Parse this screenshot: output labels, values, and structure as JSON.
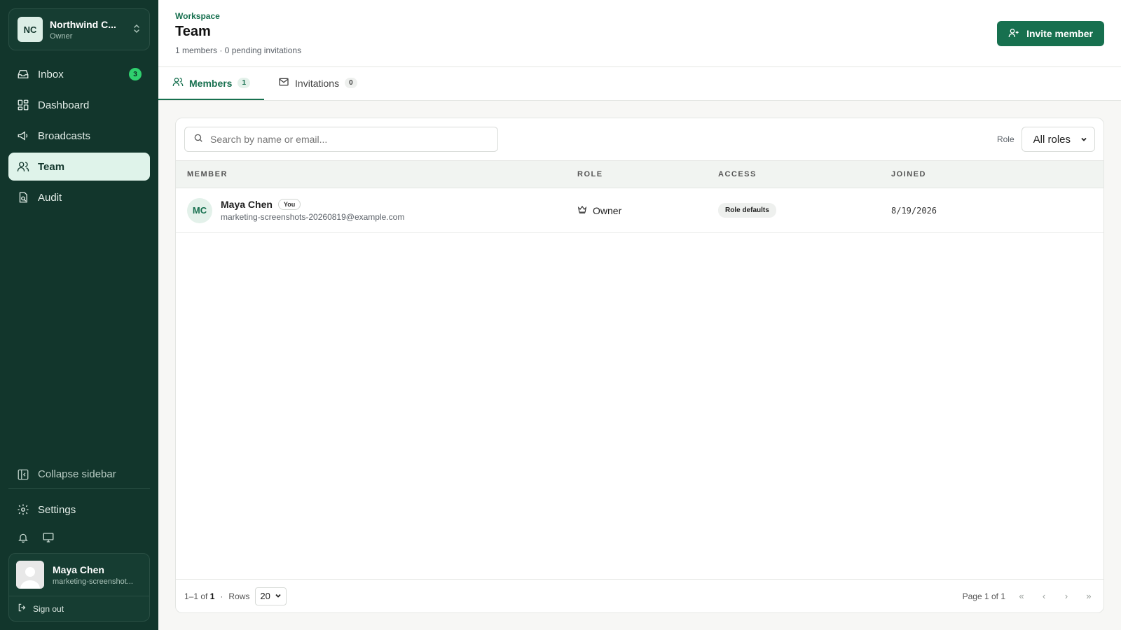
{
  "workspace": {
    "initials": "NC",
    "name": "Northwind C...",
    "role": "Owner"
  },
  "nav": [
    {
      "label": "Inbox",
      "icon": "inbox-icon",
      "badge": "3"
    },
    {
      "label": "Dashboard",
      "icon": "dashboard-icon"
    },
    {
      "label": "Broadcasts",
      "icon": "megaphone-icon"
    },
    {
      "label": "Team",
      "icon": "users-icon",
      "active": true
    },
    {
      "label": "Audit",
      "icon": "audit-icon"
    }
  ],
  "sidebar_footer": {
    "collapse_label": "Collapse sidebar",
    "settings_label": "Settings",
    "signout_label": "Sign out"
  },
  "user": {
    "name": "Maya Chen",
    "email": "marketing-screenshot..."
  },
  "header": {
    "breadcrumb": "Workspace",
    "title": "Team",
    "subtitle": "1 members · 0 pending invitations",
    "invite_label": "Invite member"
  },
  "tabs": [
    {
      "label": "Members",
      "count": "1"
    },
    {
      "label": "Invitations",
      "count": "0"
    }
  ],
  "toolbar": {
    "search_placeholder": "Search by name or email...",
    "role_label": "Role",
    "role_value": "All roles"
  },
  "table": {
    "headers": {
      "member": "MEMBER",
      "role": "ROLE",
      "access": "ACCESS",
      "joined": "JOINED"
    },
    "rows": [
      {
        "initials": "MC",
        "name": "Maya Chen",
        "you_badge": "You",
        "email": "marketing-screenshots-20260819@example.com",
        "role": "Owner",
        "access": "Role defaults",
        "joined": "8/19/2026"
      }
    ]
  },
  "footer": {
    "range": "1–1 of",
    "total": "1",
    "rows_label": "Rows",
    "rows_value": "20",
    "page_text": "Page 1 of 1"
  },
  "colors": {
    "sidebar_bg": "#12362c",
    "accent": "#17704f",
    "badge_green": "#2fd06e"
  }
}
